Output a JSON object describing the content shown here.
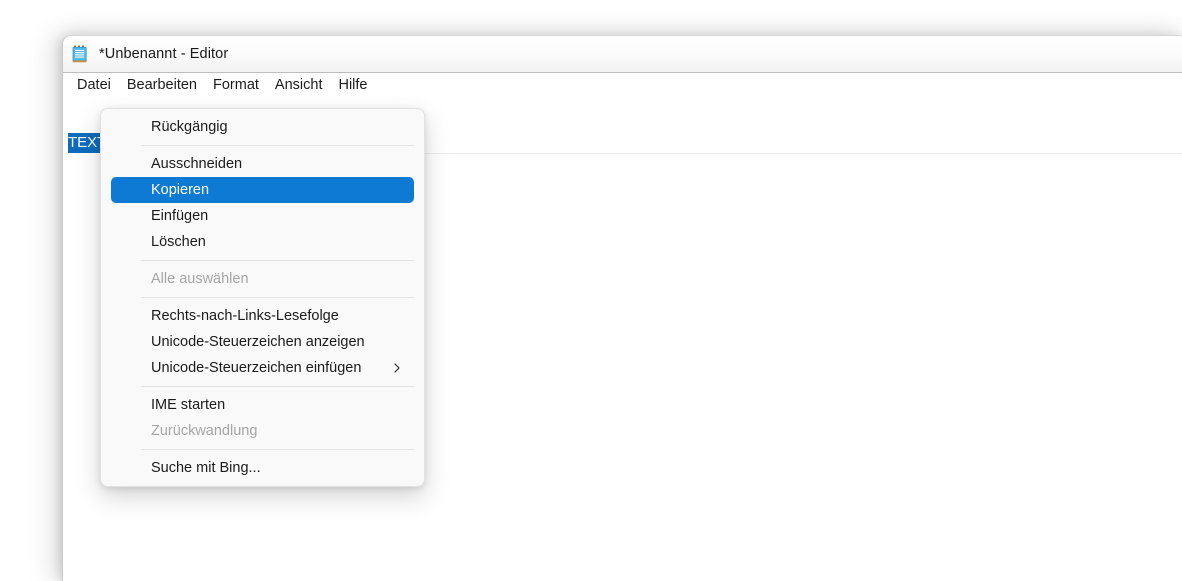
{
  "window": {
    "title": "*Unbenannt - Editor",
    "icon": "notepad-icon",
    "menubar": [
      {
        "label": "Datei"
      },
      {
        "label": "Bearbeiten"
      },
      {
        "label": "Format"
      },
      {
        "label": "Ansicht"
      },
      {
        "label": "Hilfe"
      }
    ],
    "editor": {
      "selected_text": "TEXT",
      "selection_color": "#0f6cbd"
    }
  },
  "context_menu": {
    "highlight_color": "#0f7ad4",
    "background_color": "#f9f9f9",
    "items": [
      {
        "label": "Rückgängig",
        "state": "normal",
        "submenu": false
      },
      {
        "label": "",
        "state": "separator",
        "submenu": false
      },
      {
        "label": "Ausschneiden",
        "state": "normal",
        "submenu": false
      },
      {
        "label": "Kopieren",
        "state": "selected",
        "submenu": false
      },
      {
        "label": "Einfügen",
        "state": "normal",
        "submenu": false
      },
      {
        "label": "Löschen",
        "state": "normal",
        "submenu": false
      },
      {
        "label": "",
        "state": "separator",
        "submenu": false
      },
      {
        "label": "Alle auswählen",
        "state": "disabled",
        "submenu": false
      },
      {
        "label": "",
        "state": "separator",
        "submenu": false
      },
      {
        "label": "Rechts-nach-Links-Lesefolge",
        "state": "normal",
        "submenu": false
      },
      {
        "label": "Unicode-Steuerzeichen anzeigen",
        "state": "normal",
        "submenu": false
      },
      {
        "label": "Unicode-Steuerzeichen einfügen",
        "state": "normal",
        "submenu": true
      },
      {
        "label": "",
        "state": "separator",
        "submenu": false
      },
      {
        "label": "IME starten",
        "state": "normal",
        "submenu": false
      },
      {
        "label": "Zurückwandlung",
        "state": "disabled",
        "submenu": false
      },
      {
        "label": "",
        "state": "separator",
        "submenu": false
      },
      {
        "label": "Suche mit Bing...",
        "state": "normal",
        "submenu": false
      }
    ]
  }
}
